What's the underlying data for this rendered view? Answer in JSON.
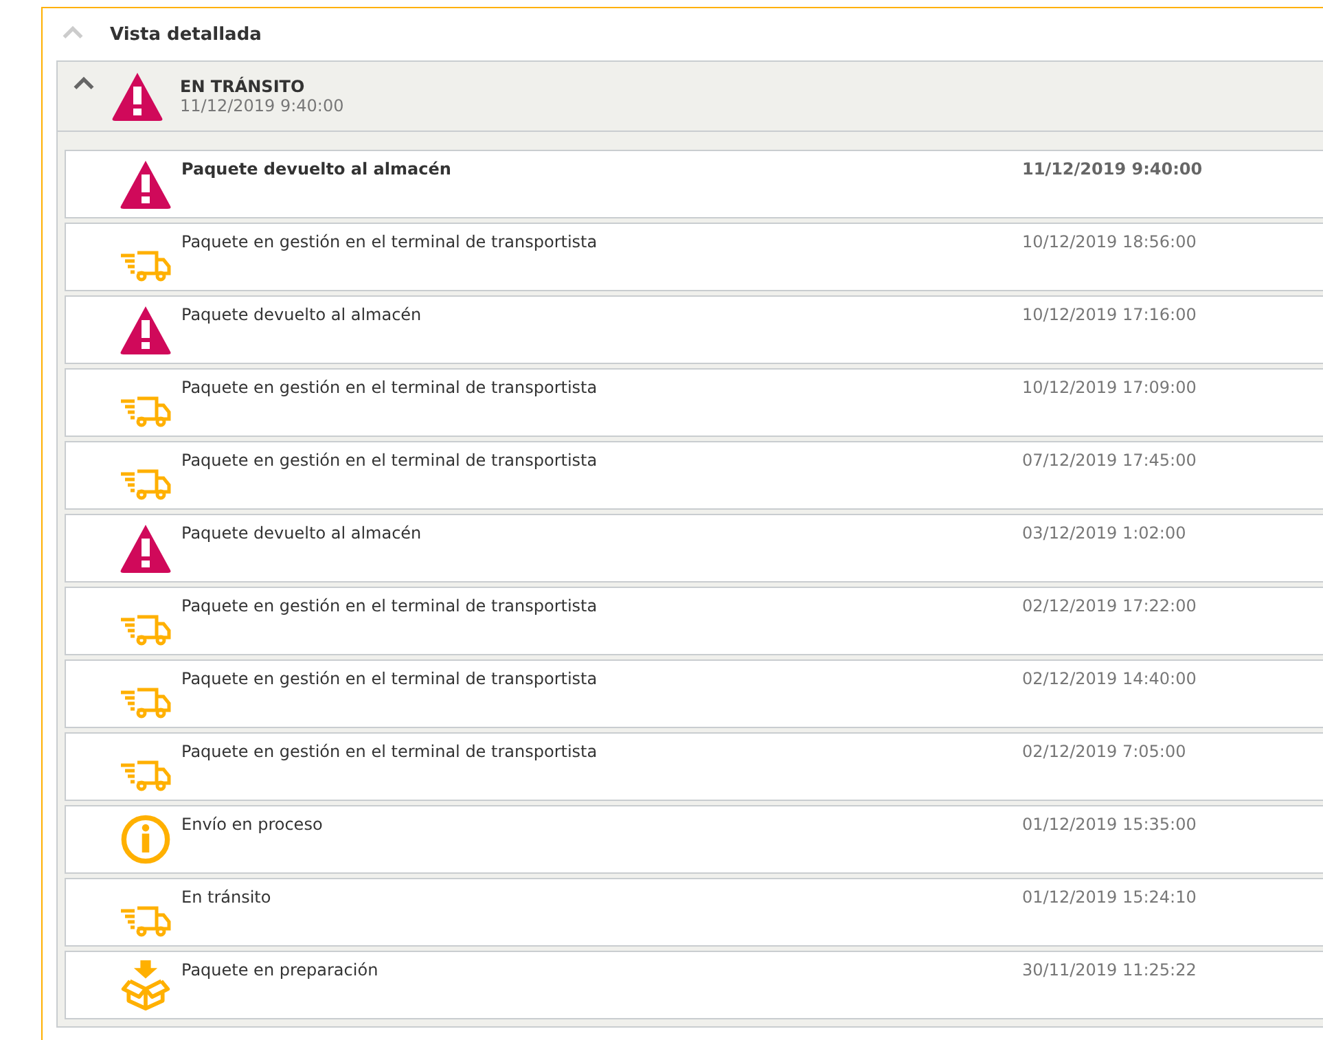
{
  "panel": {
    "title": "Vista detallada",
    "expanded": true
  },
  "status": {
    "title": "EN TRÁNSITO",
    "date": "11/12/2019 9:40:00",
    "kind": "warning",
    "expanded": true
  },
  "events": [
    {
      "kind": "warning",
      "text": "Paquete devuelto al almacén",
      "date": "11/12/2019 9:40:00",
      "current": true
    },
    {
      "kind": "truck",
      "text": "Paquete en gestión en el terminal de transportista",
      "date": "10/12/2019 18:56:00",
      "current": false
    },
    {
      "kind": "warning",
      "text": "Paquete devuelto al almacén",
      "date": "10/12/2019 17:16:00",
      "current": false
    },
    {
      "kind": "truck",
      "text": "Paquete en gestión en el terminal de transportista",
      "date": "10/12/2019 17:09:00",
      "current": false
    },
    {
      "kind": "truck",
      "text": "Paquete en gestión en el terminal de transportista",
      "date": "07/12/2019 17:45:00",
      "current": false
    },
    {
      "kind": "warning",
      "text": "Paquete devuelto al almacén",
      "date": "03/12/2019 1:02:00",
      "current": false
    },
    {
      "kind": "truck",
      "text": "Paquete en gestión en el terminal de transportista",
      "date": "02/12/2019 17:22:00",
      "current": false
    },
    {
      "kind": "truck",
      "text": "Paquete en gestión en el terminal de transportista",
      "date": "02/12/2019 14:40:00",
      "current": false
    },
    {
      "kind": "truck",
      "text": "Paquete en gestión en el terminal de transportista",
      "date": "02/12/2019 7:05:00",
      "current": false
    },
    {
      "kind": "info",
      "text": "Envío en proceso",
      "date": "01/12/2019 15:35:00",
      "current": false
    },
    {
      "kind": "truck",
      "text": "En tránsito",
      "date": "01/12/2019 15:24:10",
      "current": false
    },
    {
      "kind": "box",
      "text": "Paquete en preparación",
      "date": "30/11/2019 11:25:22",
      "current": false
    }
  ]
}
